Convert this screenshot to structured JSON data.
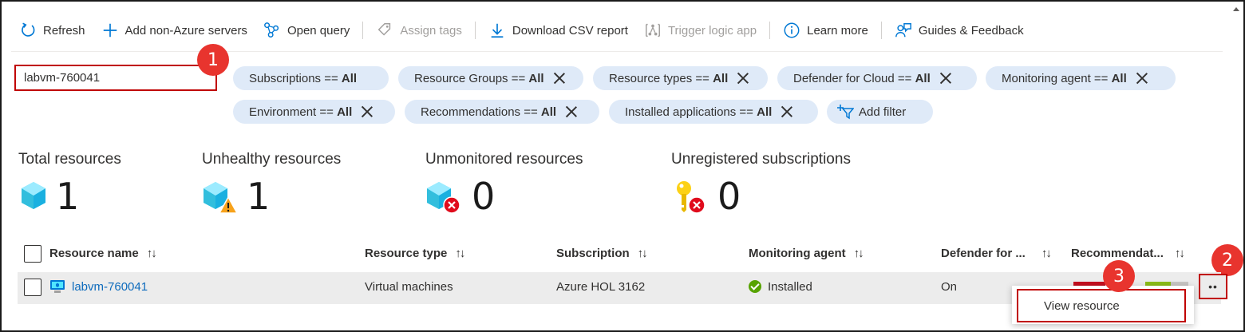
{
  "toolbar": {
    "refresh": "Refresh",
    "add_non_azure": "Add non-Azure servers",
    "open_query": "Open query",
    "assign_tags": "Assign tags",
    "download_csv": "Download CSV report",
    "trigger_logic_app": "Trigger logic app",
    "learn_more": "Learn more",
    "guides_feedback": "Guides & Feedback"
  },
  "search": {
    "value": "labvm-760041"
  },
  "filters": [
    {
      "label": "Subscriptions == ",
      "value": "All"
    },
    {
      "label": "Resource Groups == ",
      "value": "All"
    },
    {
      "label": "Resource types == ",
      "value": "All"
    },
    {
      "label": "Defender for Cloud == ",
      "value": "All"
    },
    {
      "label": "Monitoring agent == ",
      "value": "All"
    },
    {
      "label": "Environment == ",
      "value": "All"
    },
    {
      "label": "Recommendations == ",
      "value": "All"
    },
    {
      "label": "Installed applications == ",
      "value": "All"
    }
  ],
  "add_filter": "Add filter",
  "stats": {
    "total": {
      "title": "Total resources",
      "value": "1"
    },
    "unhealthy": {
      "title": "Unhealthy resources",
      "value": "1"
    },
    "unmonitored": {
      "title": "Unmonitored resources",
      "value": "0"
    },
    "unregistered": {
      "title": "Unregistered subscriptions",
      "value": "0"
    }
  },
  "table": {
    "columns": [
      "Resource name",
      "Resource type",
      "Subscription",
      "Monitoring agent",
      "Defender for ...",
      "Recommendat..."
    ],
    "sort_glyph": "↑↓",
    "rows": [
      {
        "name": "labvm-760041",
        "type": "Virtual machines",
        "subscription": "Azure HOL 3162",
        "agent": "Installed",
        "defender": "On"
      }
    ],
    "more_glyph": "••"
  },
  "context_menu": {
    "view_resource": "View resource"
  },
  "callouts": [
    "1",
    "2",
    "3"
  ],
  "colors": {
    "accent": "#0078d4",
    "callout": "#e8342e",
    "highlight_border": "#c00000",
    "pill_bg": "#dfeaf8"
  }
}
